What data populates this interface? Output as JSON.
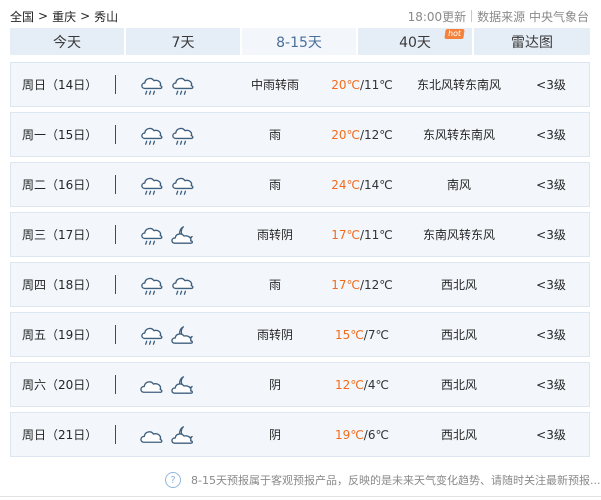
{
  "breadcrumb": {
    "root": "全国",
    "province": "重庆",
    "city": "秀山",
    "sep": ">"
  },
  "meta": {
    "updated": "18:00更新",
    "source": "数据来源 中央气象台"
  },
  "tabs": [
    {
      "label": "今天",
      "active": false
    },
    {
      "label": "7天",
      "active": false
    },
    {
      "label": "8-15天",
      "active": true
    },
    {
      "label": "40天",
      "active": false,
      "badge": "hot"
    },
    {
      "label": "雷达图",
      "active": false
    }
  ],
  "colors": {
    "tab_bg": "#e5eef7",
    "tab_active_bg": "#f3f7fb",
    "tab_active_text": "#4a6f9a",
    "row_bg": "#f3f7fb",
    "row_border": "#dde7f1",
    "temp_high": "#f26b1d",
    "icon_stroke": "#3f5f7f",
    "badge": "#f5813a"
  },
  "forecast": [
    {
      "day": "周日（14日）",
      "icons": [
        "rain-icon",
        "rain-icon"
      ],
      "weather": "中雨转雨",
      "high": "20℃",
      "low": "/11℃",
      "wind": "东北风转东南风",
      "level": "<3级"
    },
    {
      "day": "周一（15日）",
      "icons": [
        "rain-icon",
        "rain-icon"
      ],
      "weather": "雨",
      "high": "20℃",
      "low": "/12℃",
      "wind": "东风转东南风",
      "level": "<3级"
    },
    {
      "day": "周二（16日）",
      "icons": [
        "rain-icon",
        "rain-icon"
      ],
      "weather": "雨",
      "high": "24℃",
      "low": "/14℃",
      "wind": "南风",
      "level": "<3级"
    },
    {
      "day": "周三（17日）",
      "icons": [
        "rain-icon",
        "partly-cloudy-night-icon"
      ],
      "weather": "雨转阴",
      "high": "17℃",
      "low": "/11℃",
      "wind": "东南风转东风",
      "level": "<3级"
    },
    {
      "day": "周四（18日）",
      "icons": [
        "rain-icon",
        "rain-icon"
      ],
      "weather": "雨",
      "high": "17℃",
      "low": "/12℃",
      "wind": "西北风",
      "level": "<3级"
    },
    {
      "day": "周五（19日）",
      "icons": [
        "rain-icon",
        "partly-cloudy-night-icon"
      ],
      "weather": "雨转阴",
      "high": "15℃",
      "low": "/7℃",
      "wind": "西北风",
      "level": "<3级"
    },
    {
      "day": "周六（20日）",
      "icons": [
        "cloud-icon",
        "partly-cloudy-night-icon"
      ],
      "weather": "阴",
      "high": "12℃",
      "low": "/4℃",
      "wind": "西北风",
      "level": "<3级"
    },
    {
      "day": "周日（21日）",
      "icons": [
        "cloud-icon",
        "partly-cloudy-night-icon"
      ],
      "weather": "阴",
      "high": "19℃",
      "low": "/6℃",
      "wind": "西北风",
      "level": "<3级"
    }
  ],
  "footer": {
    "help_symbol": "?",
    "note": "8-15天预报属于客观预报产品，反映的是未来天气变化趋势、请随时关注最新预报...."
  }
}
